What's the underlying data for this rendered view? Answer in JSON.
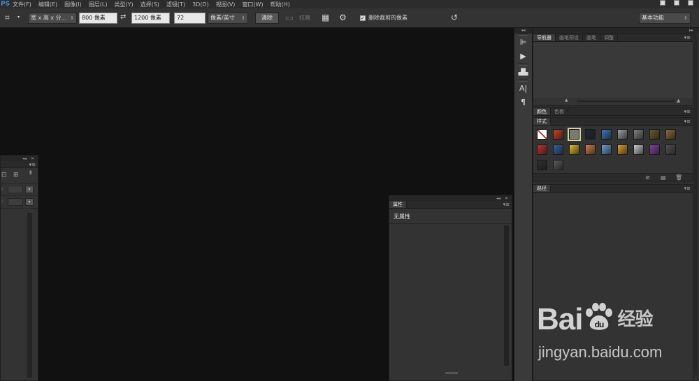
{
  "menubar": {
    "logo": "PS",
    "items": [
      "文件(F)",
      "编辑(E)",
      "图像(I)",
      "图层(L)",
      "类型(Y)",
      "选择(S)",
      "滤镜(T)",
      "3D(D)",
      "视图(V)",
      "窗口(W)",
      "帮助(H)"
    ]
  },
  "options": {
    "crop_icon": "crop-icon",
    "ratio_preset": "宽 x 高 x 分...",
    "width_value": "800 像素",
    "height_value": "1200 像素",
    "resolution_value": "72",
    "resolution_unit": "像素/英寸",
    "clear_label": "清除",
    "straighten_label": "拉直",
    "delete_cropped_checked": true,
    "delete_cropped_label": "删除裁剪的像素",
    "workspace": "基本功能"
  },
  "properties_panel": {
    "tab": "属性",
    "content": "无属性"
  },
  "navigator_panel": {
    "tabs": [
      "导航器",
      "画笔预设",
      "画笔",
      "调整"
    ]
  },
  "color_panel": {
    "tabs": [
      "颜色",
      "色板"
    ]
  },
  "styles_panel": {
    "tab": "样式",
    "swatches": [
      "#ffffff",
      "#d04020",
      "#7a7a70",
      "#202830",
      "#3a78c0",
      "#a0a0a0",
      "#808080",
      "#6b5a2a",
      "#8a6a3a",
      "#c03030",
      "#3060a0",
      "#e0c020",
      "#d08040",
      "#70a0d0",
      "#e0a020",
      "#c8c8c8",
      "#8040a0",
      "#505050",
      "#2e2e2e",
      "#5a5a5a"
    ]
  },
  "paths_panel": {
    "tab": "路径"
  },
  "watermark": {
    "brand_left": "Bai",
    "brand_right": "du",
    "brand_cn": "经验",
    "url": "jingyan.baidu.com"
  },
  "colors": {
    "canvas": "#111111",
    "panel": "#333333",
    "accent": "#4a8ed8"
  }
}
